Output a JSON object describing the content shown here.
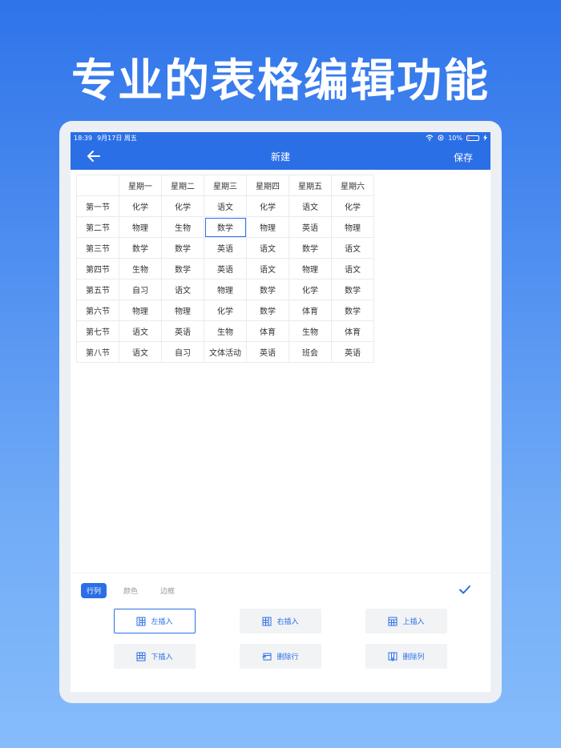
{
  "headline": "专业的表格编辑功能",
  "status": {
    "time": "18:39",
    "date": "9月17日 周五",
    "battery": "10%"
  },
  "nav": {
    "title": "新建",
    "save_label": "保存"
  },
  "table": {
    "header": [
      "",
      "星期一",
      "星期二",
      "星期三",
      "星期四",
      "星期五",
      "星期六"
    ],
    "rows": [
      [
        "第一节",
        "化学",
        "化学",
        "语文",
        "化学",
        "语文",
        "化学"
      ],
      [
        "第二节",
        "物理",
        "生物",
        "数学",
        "物理",
        "英语",
        "物理"
      ],
      [
        "第三节",
        "数学",
        "数学",
        "英语",
        "语文",
        "数学",
        "语文"
      ],
      [
        "第四节",
        "生物",
        "数学",
        "英语",
        "语文",
        "物理",
        "语文"
      ],
      [
        "第五节",
        "自习",
        "语文",
        "物理",
        "数学",
        "化学",
        "数学"
      ],
      [
        "第六节",
        "物理",
        "物理",
        "化学",
        "数学",
        "体育",
        "数学"
      ],
      [
        "第七节",
        "语文",
        "英语",
        "生物",
        "体育",
        "生物",
        "体育"
      ],
      [
        "第八节",
        "语文",
        "自习",
        "文体活动",
        "英语",
        "班会",
        "英语"
      ]
    ],
    "selected_cell": {
      "row": 1,
      "col": 3
    }
  },
  "panel": {
    "tabs": [
      "行列",
      "颜色",
      "边框"
    ],
    "active_tab": 0,
    "buttons": [
      {
        "label": "左插入",
        "icon": "insert-left-icon"
      },
      {
        "label": "右插入",
        "icon": "insert-right-icon"
      },
      {
        "label": "上插入",
        "icon": "insert-above-icon"
      },
      {
        "label": "下插入",
        "icon": "insert-below-icon"
      },
      {
        "label": "删除行",
        "icon": "delete-row-icon"
      },
      {
        "label": "删除列",
        "icon": "delete-column-icon"
      }
    ]
  },
  "colors": {
    "accent": "#2b6fe6",
    "cell_border": "#e8ebf0"
  }
}
